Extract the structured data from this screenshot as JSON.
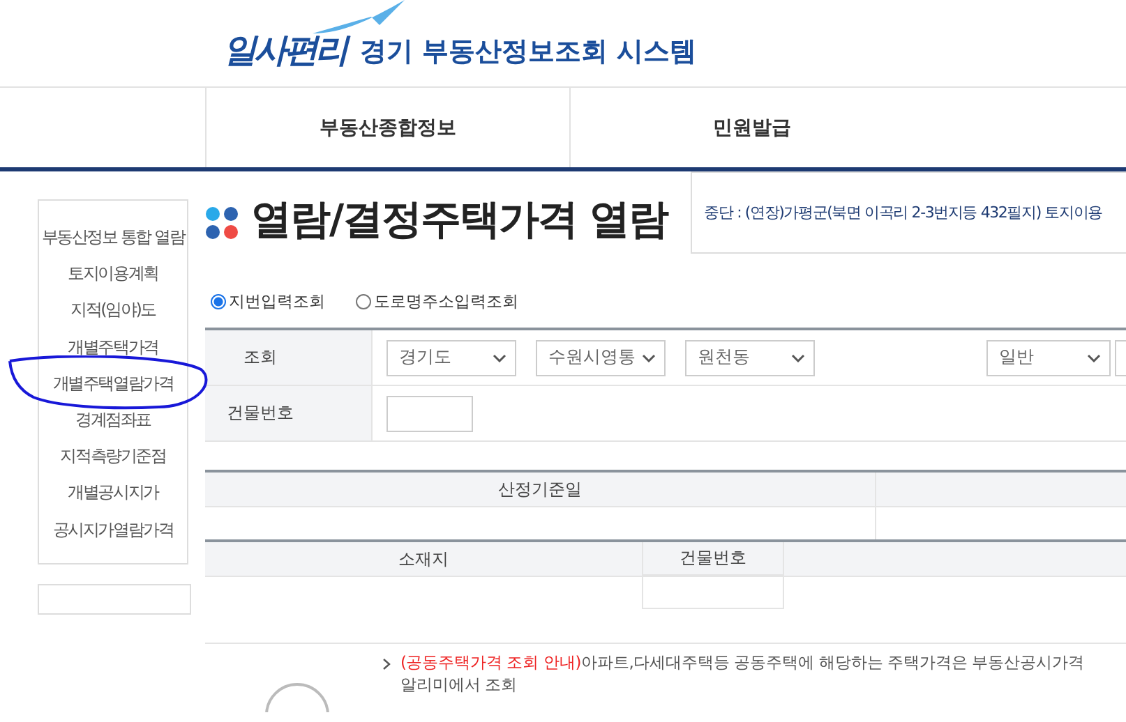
{
  "header": {
    "logo": "일사편리",
    "title": "경기 부동산정보조회 시스템"
  },
  "nav": [
    {
      "label": "부동산종합정보"
    },
    {
      "label": "민원발급"
    }
  ],
  "sidebar": {
    "items": [
      {
        "label": "부동산정보 통합 열람",
        "highlighted": false
      },
      {
        "label": "토지이용계획",
        "highlighted": false
      },
      {
        "label": "지적(임야)도",
        "highlighted": false
      },
      {
        "label": "개별주택가격",
        "highlighted": false
      },
      {
        "label": "개별주택열람가격",
        "highlighted": true
      },
      {
        "label": "경계점좌표",
        "highlighted": false
      },
      {
        "label": "지적측량기준점",
        "highlighted": false
      },
      {
        "label": "개별공시지가",
        "highlighted": false
      },
      {
        "label": "공시지가열람가격",
        "highlighted": false
      }
    ]
  },
  "page_title": "열람/결정주택가격 열람",
  "notice": "중단 : (연장)가평군(북면 이곡리 2-3번지등 432필지) 토지이용",
  "search_modes": [
    {
      "label": "지번입력조회",
      "selected": true
    },
    {
      "label": "도로명주소입력조회",
      "selected": false
    }
  ],
  "form": {
    "query_label": "조회",
    "selects": [
      "경기도",
      "수원시영통",
      "원천동",
      "일반"
    ],
    "building_label": "건물번호"
  },
  "table_1": {
    "columns": [
      "산정기준일"
    ]
  },
  "table_2": {
    "columns": [
      "소재지",
      "건물번호"
    ]
  },
  "info": {
    "highlight": "(공동주택가격 조회 안내)",
    "text": "아파트,다세대주택등 공동주택에 해당하는 주택가격은 부동산공시가격알리미에서 조회"
  }
}
